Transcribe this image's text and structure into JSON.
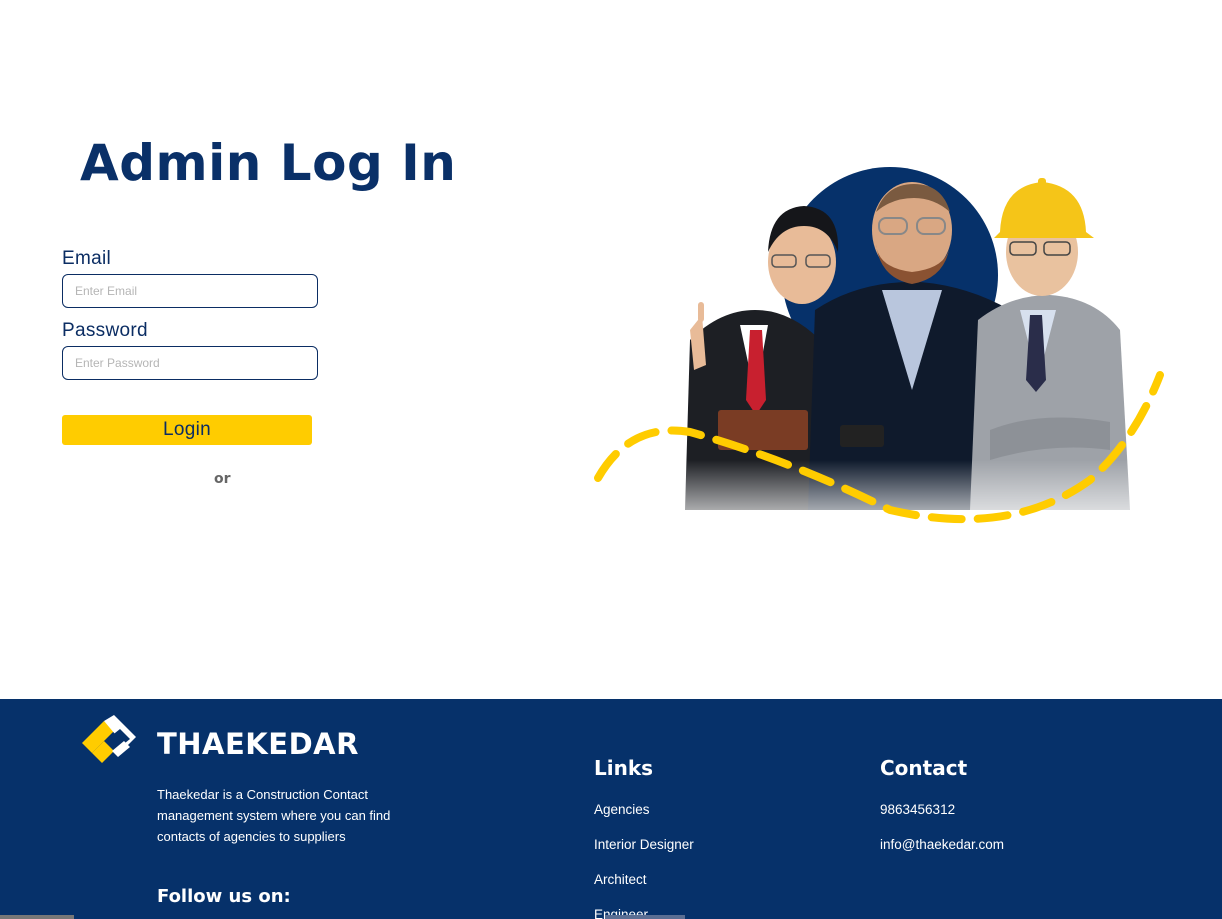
{
  "page": {
    "title": "Admin Log In"
  },
  "login_form": {
    "email_label": "Email",
    "email_placeholder": "Enter Email",
    "email_value": "",
    "password_label": "Password",
    "password_placeholder": "Enter Password",
    "password_value": "",
    "login_button": "Login",
    "or_text": "or"
  },
  "hero": {
    "image": "three-professionals-with-hard-hat-icon",
    "accent_circle_color": "#06316a",
    "dashed_arc_color": "#ffcc00"
  },
  "footer": {
    "brand": {
      "name": "THAEKEDAR",
      "logo": "thaekedar-logo-icon",
      "description": "Thaekedar is a Construction Contact management system where you can find contacts of agencies to suppliers"
    },
    "follow_title": "Follow us on:",
    "links": {
      "title": "Links",
      "items": [
        "Agencies",
        "Interior Designer",
        "Architect",
        "Engineer"
      ]
    },
    "contact": {
      "title": "Contact",
      "phone": "9863456312",
      "email": "info@thaekedar.com"
    }
  },
  "colors": {
    "primary_navy": "#06316a",
    "accent_yellow": "#ffcc00",
    "background": "#ffffff"
  }
}
